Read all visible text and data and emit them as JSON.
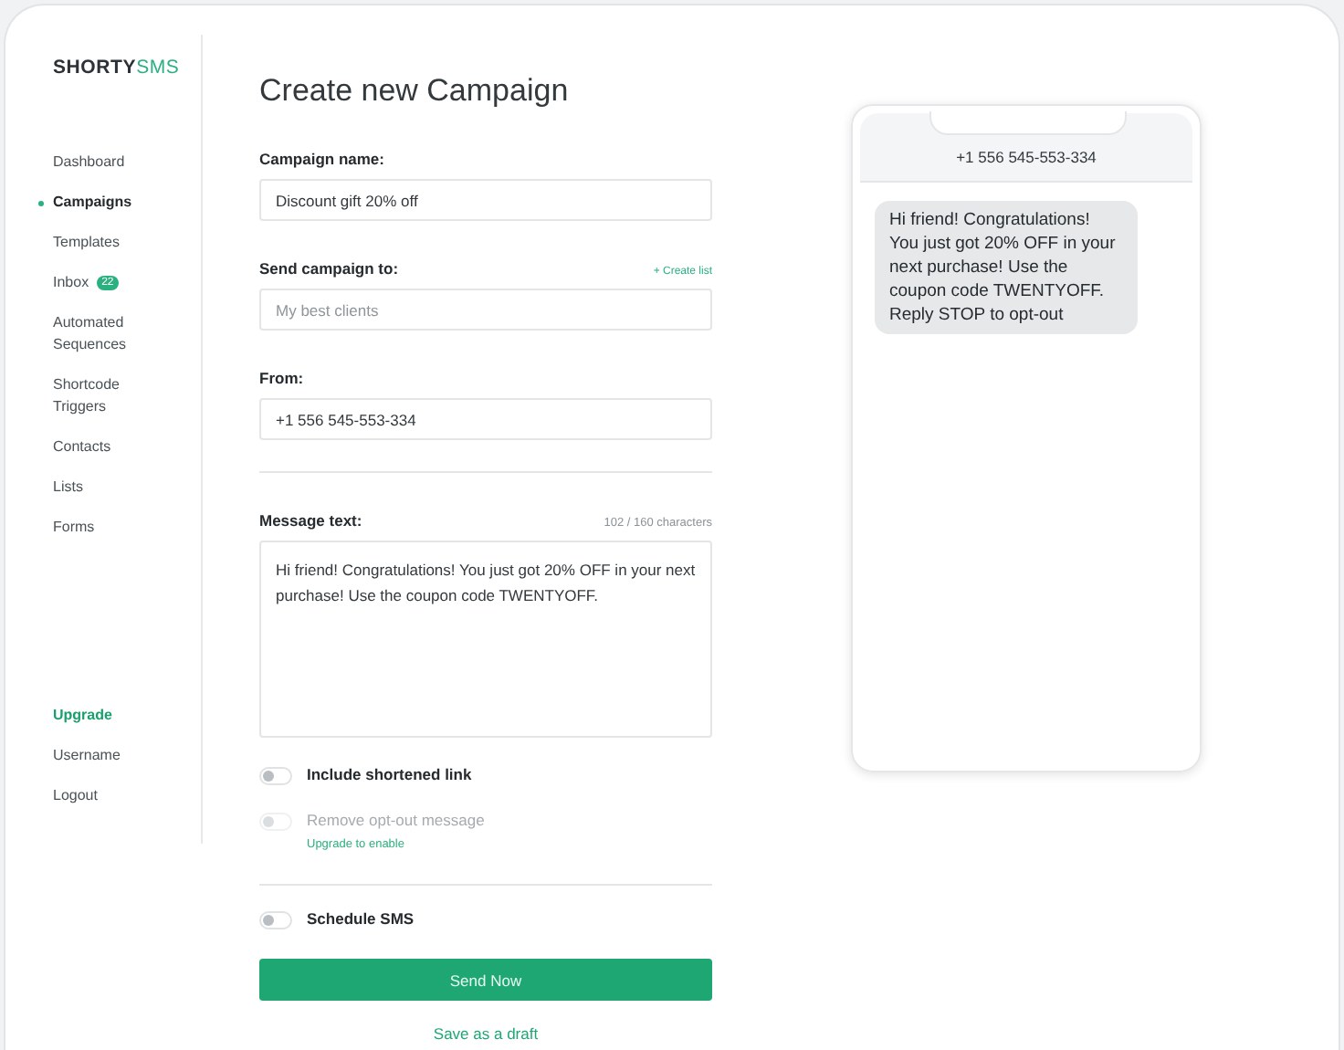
{
  "logo": {
    "brand": "SHORTY",
    "suffix": "SMS"
  },
  "sidebar": {
    "items": [
      {
        "label": "Dashboard",
        "selected": false
      },
      {
        "label": "Campaigns",
        "selected": true
      },
      {
        "label": "Templates",
        "selected": false
      },
      {
        "label": "Inbox",
        "selected": false,
        "badge": "22"
      },
      {
        "label": "Automated Sequences",
        "selected": false
      },
      {
        "label": "Shortcode Triggers",
        "selected": false
      },
      {
        "label": "Contacts",
        "selected": false
      },
      {
        "label": "Lists",
        "selected": false
      },
      {
        "label": "Forms",
        "selected": false
      }
    ],
    "bottom_items": [
      {
        "label": "Upgrade",
        "kind": "accent"
      },
      {
        "label": "Username",
        "kind": "plain"
      },
      {
        "label": "Logout",
        "kind": "plain"
      }
    ]
  },
  "title": "Create new Campaign",
  "fields": [
    {
      "label": "Campaign name:",
      "value": "Discount gift 20% off"
    },
    {
      "label": "Send campaign to:",
      "placeholder": "My best clients",
      "link": "+ Create list"
    },
    {
      "label": "From:",
      "value": "+1 556 545-553-334"
    }
  ],
  "message": {
    "label": "Message text:",
    "counter": "102 / 160 characters",
    "value": "Hi friend! Congratulations! You just got 20% OFF in your next purchase! Use the coupon code TWENTYOFF."
  },
  "toggles": [
    {
      "label": "Include shortened link",
      "on": false,
      "disabled": false
    },
    {
      "label": "Remove opt-out message",
      "on": false,
      "disabled": true,
      "hint": "Upgrade to enable"
    }
  ],
  "schedule": {
    "label": "Schedule SMS",
    "on": false,
    "disabled": false
  },
  "send_button": "Send Now",
  "draft_link": "Save as a draft",
  "preview": {
    "number": "+1 556 545-553-334",
    "bubble": "Hi friend! Congratulations! You just got 20% OFF in your next purchase! Use the coupon code TWENTYOFF. Reply STOP to opt-out"
  }
}
